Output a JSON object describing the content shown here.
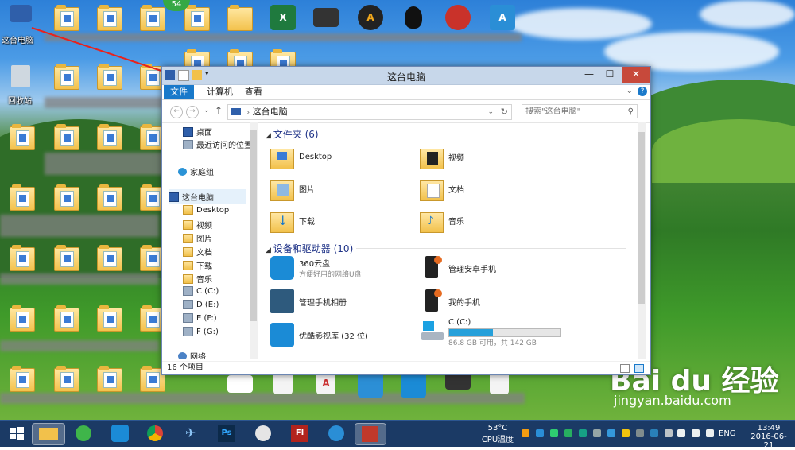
{
  "desktop": {
    "badge": "54",
    "icon_labels": [
      "这台电脑",
      "回收站"
    ]
  },
  "window": {
    "title": "这台电脑",
    "controls": {
      "minimize": "—",
      "maximize": "☐",
      "close": "✕"
    },
    "ribbon_tabs": [
      "文件",
      "计算机",
      "查看"
    ],
    "address": "这台电脑",
    "search_placeholder": "搜索\"这台电脑\"",
    "nav": {
      "quick": [
        "桌面",
        "最近访问的位置"
      ],
      "homegroup": "家庭组",
      "this_pc": "这台电脑",
      "this_pc_children": [
        "Desktop",
        "视频",
        "图片",
        "文档",
        "下载",
        "音乐",
        "C (C:)",
        "D (E:)",
        "E (F:)",
        "F (G:)"
      ],
      "network": "网络"
    },
    "folders_header": "文件夹 (6)",
    "folders": [
      "Desktop",
      "视频",
      "图片",
      "文档",
      "下载",
      "音乐"
    ],
    "devices_header": "设备和驱动器 (10)",
    "devices": [
      {
        "name": "360云盘",
        "sub": "方便好用的网络U盘"
      },
      {
        "name": "管理安卓手机",
        "sub": ""
      },
      {
        "name": "管理手机相册",
        "sub": ""
      },
      {
        "name": "我的手机",
        "sub": ""
      },
      {
        "name": "优酷影视库 (32 位)",
        "sub": ""
      },
      {
        "name": "C (C:)",
        "sub": "86.8 GB 可用，共 142 GB",
        "used_fraction": 0.39
      }
    ],
    "status": "16 个项目"
  },
  "taskbar": {
    "temp": "53°C",
    "temp_label": "CPU温度",
    "lang": "ENG",
    "time": "13:49",
    "date": "2016-06-21"
  },
  "watermark": {
    "brand": "Bai du 经验",
    "url": "jingyan.baidu.com"
  },
  "colors": {
    "accent": "#1979ca",
    "close": "#c7493b",
    "taskbar": "#1b3a65"
  }
}
